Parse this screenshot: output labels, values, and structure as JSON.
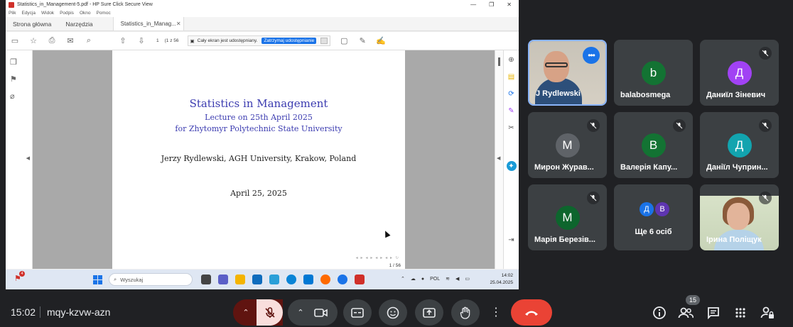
{
  "pdf_window": {
    "title": "Statistics_in_Management-5.pdf - HP Sure Click Secure View",
    "menu": [
      "Plik",
      "Edycja",
      "Widok",
      "Podpis",
      "Okno",
      "Pomoc"
    ],
    "tabs": [
      "Strona główna",
      "Narzędzia",
      "Statistics_in_Manag..."
    ],
    "page_current": "1",
    "page_total": "(1 z 56",
    "share_notice": "Cały ekran jest udostępniany.",
    "stop_share_label": "Zatrzymaj udostępnianie"
  },
  "slide": {
    "title": "Statistics in Management",
    "subtitle1": "Lecture on 25th April 2025",
    "subtitle2": "for Zhytomyr Polytechnic State University",
    "author": "Jerzy Rydlewski, AGH University, Krakow, Poland",
    "date": "April 25, 2025",
    "page_indicator": "1 / 56"
  },
  "taskbar": {
    "notification_count": "4",
    "search_placeholder": "Wyszukaj",
    "language": "POL",
    "time": "14:02",
    "date": "25.04.2025"
  },
  "participants": [
    {
      "name": "J Rydlewski",
      "type": "video",
      "active": true
    },
    {
      "name": "balabosmega",
      "initial": "b",
      "color": "#137333",
      "muted": false
    },
    {
      "name": "Даниїл Зіневич",
      "initial": "Д",
      "color": "#a142f4",
      "muted": true
    },
    {
      "name": "Мирон Журав...",
      "initial": "М",
      "color": "#5f6368",
      "muted": true
    },
    {
      "name": "Валерія Капу...",
      "initial": "В",
      "color": "#137333",
      "muted": true
    },
    {
      "name": "Даніїл Чуприн...",
      "initial": "Д",
      "color": "#12a4af",
      "muted": true
    },
    {
      "name": "Марія Березів...",
      "initial": "М",
      "color": "#0d652d",
      "muted": true
    },
    {
      "name": "Ще 6 осіб",
      "type": "group",
      "initials": [
        "Д",
        "В"
      ],
      "colors": [
        "#1a73e8",
        "#5e35b1"
      ]
    },
    {
      "name": "Ірина Поліщук",
      "type": "video",
      "muted": true
    }
  ],
  "meet": {
    "time": "15:02",
    "code": "mqy-kzvw-azn",
    "participant_count": "15"
  }
}
